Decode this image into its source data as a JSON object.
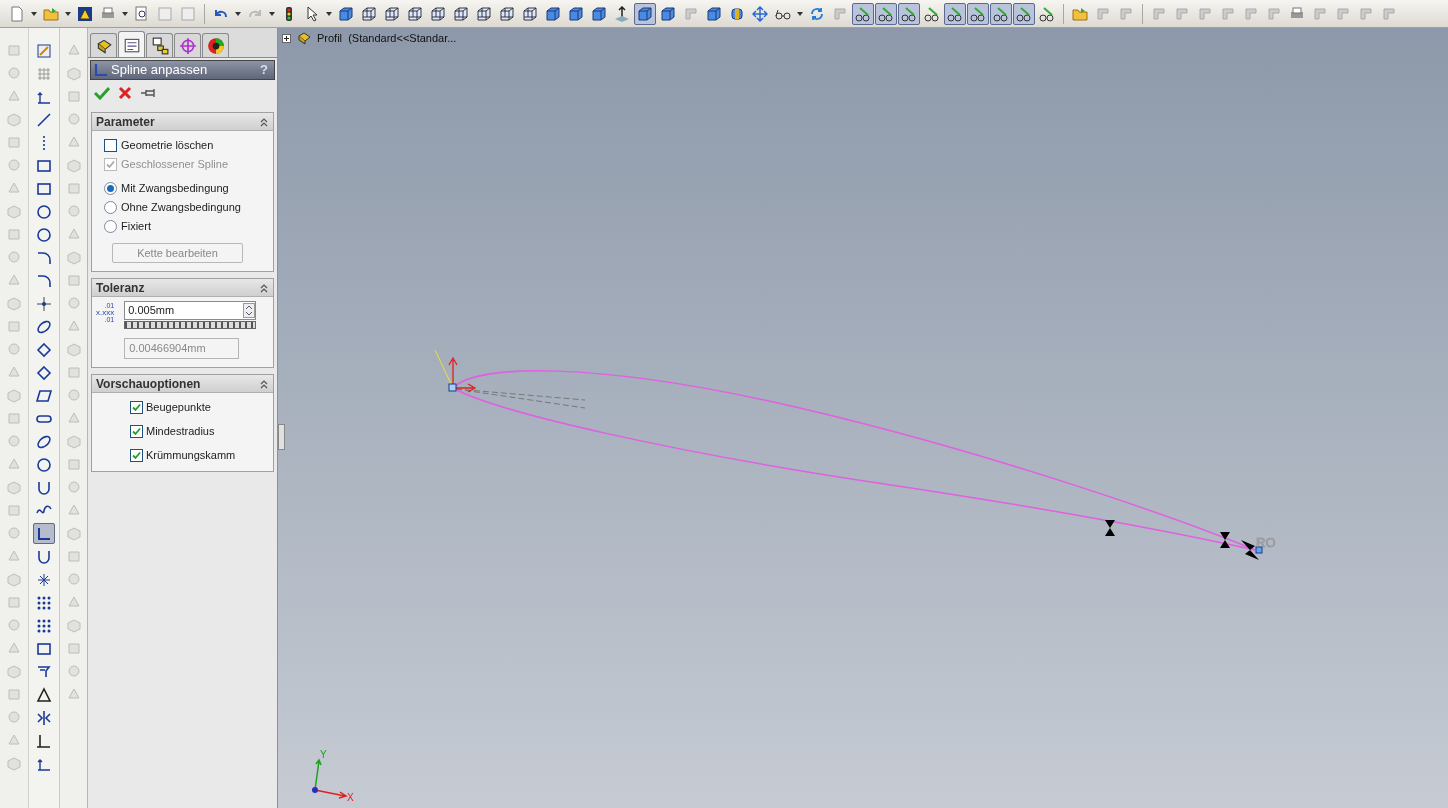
{
  "toolbar_groups": [
    [
      {
        "kind": "file",
        "pressed": false,
        "menu": true
      },
      {
        "kind": "folder",
        "pressed": false,
        "menu": true
      },
      {
        "kind": "warning",
        "pressed": false,
        "menu": false
      },
      {
        "kind": "printer",
        "pressed": false,
        "menu": true
      },
      {
        "kind": "preview",
        "pressed": false,
        "menu": false
      },
      {
        "kind": "doc",
        "pressed": false,
        "menu": false
      },
      {
        "kind": "doc",
        "pressed": false,
        "menu": false
      }
    ],
    [
      {
        "kind": "undo",
        "pressed": false,
        "menu": true
      },
      {
        "kind": "redo",
        "pressed": false,
        "menu": true
      },
      {
        "kind": "traffic",
        "pressed": false,
        "menu": false
      },
      {
        "kind": "cursor",
        "pressed": false,
        "menu": true
      },
      {
        "kind": "cube",
        "pressed": false,
        "menu": false
      },
      {
        "kind": "wire",
        "pressed": false,
        "menu": false
      },
      {
        "kind": "wire",
        "pressed": false,
        "menu": false
      },
      {
        "kind": "wire",
        "pressed": false,
        "menu": false
      },
      {
        "kind": "wire",
        "pressed": false,
        "menu": false
      },
      {
        "kind": "wire",
        "pressed": false,
        "menu": false
      },
      {
        "kind": "wire",
        "pressed": false,
        "menu": false
      },
      {
        "kind": "wire",
        "pressed": false,
        "menu": false
      },
      {
        "kind": "wire",
        "pressed": false,
        "menu": false
      },
      {
        "kind": "cube",
        "pressed": false,
        "menu": false
      },
      {
        "kind": "cube",
        "pressed": false,
        "menu": false
      },
      {
        "kind": "cube",
        "pressed": false,
        "menu": false
      },
      {
        "kind": "normal",
        "pressed": false,
        "menu": false
      },
      {
        "kind": "cube",
        "pressed": true,
        "menu": false
      },
      {
        "kind": "cube",
        "pressed": false,
        "menu": false
      },
      {
        "kind": "grey",
        "pressed": false,
        "menu": false
      },
      {
        "kind": "cube",
        "pressed": false,
        "menu": false
      },
      {
        "kind": "cylinder",
        "pressed": false,
        "menu": false
      },
      {
        "kind": "move",
        "pressed": false,
        "menu": false
      },
      {
        "kind": "glasses",
        "pressed": false,
        "menu": true
      },
      {
        "kind": "refresh",
        "pressed": false,
        "menu": false
      },
      {
        "kind": "grey",
        "pressed": false,
        "menu": false
      },
      {
        "kind": "relation",
        "pressed": true,
        "menu": false
      },
      {
        "kind": "relation",
        "pressed": true,
        "menu": false
      },
      {
        "kind": "relation",
        "pressed": true,
        "menu": false
      },
      {
        "kind": "relation",
        "pressed": false,
        "menu": false
      },
      {
        "kind": "relation",
        "pressed": true,
        "menu": false
      },
      {
        "kind": "relation",
        "pressed": true,
        "menu": false
      },
      {
        "kind": "relation",
        "pressed": true,
        "menu": false
      },
      {
        "kind": "relation",
        "pressed": true,
        "menu": false
      },
      {
        "kind": "relation",
        "pressed": false,
        "menu": false
      }
    ],
    [
      {
        "kind": "folder",
        "pressed": false,
        "menu": false
      },
      {
        "kind": "grey",
        "pressed": false,
        "menu": false
      },
      {
        "kind": "grey",
        "pressed": false,
        "menu": false
      }
    ],
    [
      {
        "kind": "grey",
        "pressed": false,
        "menu": false
      },
      {
        "kind": "grey",
        "pressed": false,
        "menu": false
      },
      {
        "kind": "grey",
        "pressed": false,
        "menu": false
      },
      {
        "kind": "grey",
        "pressed": false,
        "menu": false
      },
      {
        "kind": "grey",
        "pressed": false,
        "menu": false
      },
      {
        "kind": "grey",
        "pressed": false,
        "menu": false
      },
      {
        "kind": "printer",
        "pressed": false,
        "menu": false
      },
      {
        "kind": "grey",
        "pressed": false,
        "menu": false
      },
      {
        "kind": "grey",
        "pressed": false,
        "menu": false
      },
      {
        "kind": "grey",
        "pressed": false,
        "menu": false
      },
      {
        "kind": "grey",
        "pressed": false,
        "menu": false
      }
    ]
  ],
  "sketch_tools": [
    {
      "kind": "sketch",
      "selected": false
    },
    {
      "kind": "grid",
      "selected": false
    },
    {
      "kind": "dimension",
      "selected": false
    },
    {
      "kind": "line",
      "selected": false
    },
    {
      "kind": "centerline",
      "selected": false
    },
    {
      "kind": "rect",
      "selected": false
    },
    {
      "kind": "rect",
      "selected": false
    },
    {
      "kind": "circle",
      "selected": false
    },
    {
      "kind": "circle",
      "selected": false
    },
    {
      "kind": "arc",
      "selected": false
    },
    {
      "kind": "arc",
      "selected": false
    },
    {
      "kind": "point",
      "selected": false
    },
    {
      "kind": "ellipse",
      "selected": false
    },
    {
      "kind": "polygon",
      "selected": false
    },
    {
      "kind": "polygon",
      "selected": false
    },
    {
      "kind": "parallelogram",
      "selected": false
    },
    {
      "kind": "slot",
      "selected": false
    },
    {
      "kind": "ellipse",
      "selected": false
    },
    {
      "kind": "circle",
      "selected": false
    },
    {
      "kind": "u",
      "selected": false
    },
    {
      "kind": "spline",
      "selected": false
    },
    {
      "kind": "fit",
      "selected": true
    },
    {
      "kind": "u",
      "selected": false
    },
    {
      "kind": "star",
      "selected": false
    },
    {
      "kind": "pattern",
      "selected": false
    },
    {
      "kind": "pattern",
      "selected": false
    },
    {
      "kind": "rect",
      "selected": false
    },
    {
      "kind": "offset",
      "selected": false
    },
    {
      "kind": "warning",
      "selected": false
    },
    {
      "kind": "mirror",
      "selected": false
    },
    {
      "kind": "axis",
      "selected": false
    },
    {
      "kind": "dimension",
      "selected": false
    }
  ],
  "feature_tree": {
    "label": "Profil  (Standard<<Standar..."
  },
  "property_manager": {
    "tabs": [
      {
        "kind": "part",
        "selected": false
      },
      {
        "kind": "properties",
        "selected": true
      },
      {
        "kind": "config",
        "selected": false
      },
      {
        "kind": "target",
        "selected": false
      },
      {
        "kind": "appearance",
        "selected": false
      }
    ],
    "title": "Spline anpassen",
    "help": "?",
    "parameter": {
      "title": "Parameter",
      "options": [
        {
          "kind": "checkbox",
          "label": "Geometrie löschen",
          "checked": false,
          "disabled": false
        },
        {
          "kind": "checkbox",
          "label": "Geschlossener Spline",
          "checked": true,
          "disabled": true
        },
        {
          "kind": "radio",
          "label": "Mit Zwangsbedingung",
          "selected": true,
          "disabled": false
        },
        {
          "kind": "radio",
          "label": "Ohne Zwangsbedingung",
          "selected": false,
          "disabled": false
        },
        {
          "kind": "radio",
          "label": "Fixiert",
          "selected": false,
          "disabled": false
        }
      ],
      "button": {
        "label": "Kette bearbeiten",
        "disabled": true
      }
    },
    "tolerance": {
      "title": "Toleranz",
      "symbol": {
        "main": "x.xxx",
        "upper": ".01",
        "lower": ".01"
      },
      "value": "0.005mm",
      "readout": "0.00466904mm"
    },
    "preview": {
      "title": "Vorschauoptionen",
      "options": [
        {
          "label": "Beugepunkte",
          "checked": true
        },
        {
          "label": "Mindestradius",
          "checked": true
        },
        {
          "label": "Krümmungskamm",
          "checked": true
        }
      ]
    }
  },
  "canvas": {
    "point_label": "RO",
    "axis_y": "Y",
    "axis_x": "X"
  }
}
